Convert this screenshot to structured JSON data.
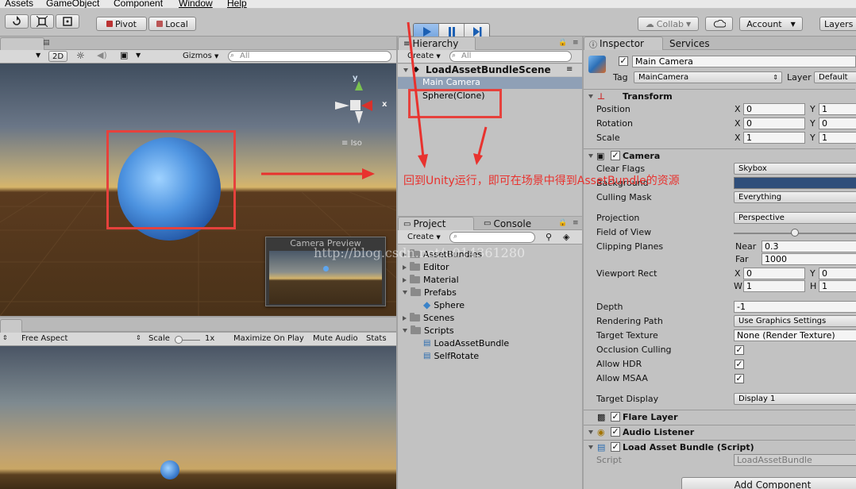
{
  "menubar": {
    "items": [
      "Assets",
      "GameObject",
      "Component",
      "Window",
      "Help"
    ]
  },
  "toolbar": {
    "pivot": "Pivot",
    "local": "Local",
    "collab": "Collab",
    "account": "Account",
    "layers": "Layers"
  },
  "scene": {
    "mode_2d": "2D",
    "gizmos": "Gizmos",
    "search_placeholder": "All",
    "iso_label": "Iso",
    "axis_y": "y",
    "axis_x": "x",
    "camera_preview": "Camera Preview"
  },
  "game": {
    "aspect": "Free Aspect",
    "scale_label": "Scale",
    "scale_value": "1x",
    "maximize": "Maximize On Play",
    "mute": "Mute Audio",
    "stats": "Stats"
  },
  "hierarchy": {
    "tab": "Hierarchy",
    "create": "Create",
    "search_placeholder": "All",
    "scene_name": "LoadAssetBundleScene",
    "items": [
      "Main Camera",
      "Sphere(Clone)"
    ]
  },
  "project": {
    "tab": "Project",
    "console_tab": "Console",
    "create": "Create",
    "folders": [
      "AssetBundles",
      "Editor",
      "Material",
      "Prefabs",
      "Sphere",
      "Scenes",
      "Scripts",
      "LoadAssetBundle",
      "SelfRotate"
    ]
  },
  "inspector": {
    "tab": "Inspector",
    "services_tab": "Services",
    "object_name": "Main Camera",
    "tag_label": "Tag",
    "tag_value": "MainCamera",
    "layer_label": "Layer",
    "layer_value": "Default",
    "transform": {
      "title": "Transform",
      "position_label": "Position",
      "rotation_label": "Rotation",
      "scale_label": "Scale",
      "x_label": "X",
      "y_label": "Y",
      "position": [
        "0",
        "1"
      ],
      "rotation": [
        "0",
        "0"
      ],
      "scale": [
        "1",
        "1"
      ]
    },
    "camera": {
      "title": "Camera",
      "clear_flags_label": "Clear Flags",
      "clear_flags": "Skybox",
      "background_label": "Background",
      "culling_mask_label": "Culling Mask",
      "culling_mask": "Everything",
      "projection_label": "Projection",
      "projection": "Perspective",
      "fov_label": "Field of View",
      "clipping_label": "Clipping Planes",
      "near_label": "Near",
      "near": "0.3",
      "far_label": "Far",
      "far": "1000",
      "viewport_label": "Viewport Rect",
      "vp_x_label": "X",
      "vp_y_label": "Y",
      "vp_w_label": "W",
      "vp_h_label": "H",
      "vp_x": "0",
      "vp_y": "0",
      "vp_w": "1",
      "vp_h": "1",
      "depth_label": "Depth",
      "depth": "-1",
      "rendering_path_label": "Rendering Path",
      "rendering_path": "Use Graphics Settings",
      "target_texture_label": "Target Texture",
      "target_texture": "None (Render Texture)",
      "occlusion_label": "Occlusion Culling",
      "hdr_label": "Allow HDR",
      "msaa_label": "Allow MSAA",
      "target_display_label": "Target Display",
      "target_display": "Display 1"
    },
    "flare_layer": "Flare Layer",
    "audio_listener": "Audio Listener",
    "script_component": "Load Asset Bundle (Script)",
    "script_label": "Script",
    "script_value": "LoadAssetBundle",
    "add_component": "Add Component"
  },
  "annotation": {
    "text": "回到Unity运行，即可在场景中得到AssetBundle的资源",
    "color": "#e8322e"
  },
  "watermark": "http://blog.csdn.net/u014361280"
}
